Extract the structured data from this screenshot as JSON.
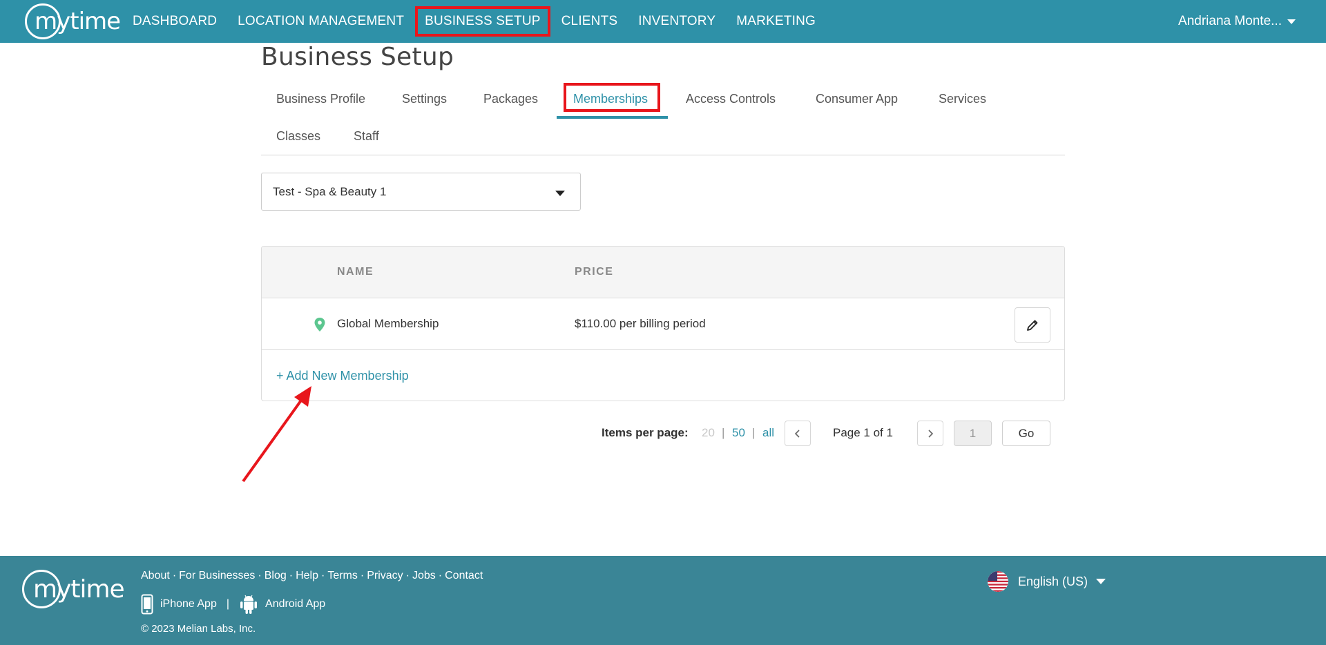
{
  "nav": {
    "items": [
      "DASHBOARD",
      "LOCATION MANAGEMENT",
      "BUSINESS SETUP",
      "CLIENTS",
      "INVENTORY",
      "MARKETING"
    ],
    "active": "BUSINESS SETUP",
    "user_name": "Andriana Monte..."
  },
  "logo_text": "mytime",
  "page": {
    "title": "Business Setup",
    "tabs_row1": [
      "Business Profile",
      "Settings",
      "Packages",
      "Memberships",
      "Access Controls",
      "Consumer App",
      "Services"
    ],
    "tabs_row2": [
      "Classes",
      "Staff"
    ],
    "active_tab": "Memberships"
  },
  "location_select": {
    "value": "Test - Spa & Beauty 1"
  },
  "table": {
    "headers": {
      "name": "NAME",
      "price": "PRICE"
    },
    "rows": [
      {
        "name": "Global Membership",
        "price": "$110.00 per billing period",
        "icon": "location-pin-icon"
      }
    ],
    "add_link": "+ Add New Membership"
  },
  "pagination": {
    "items_per_page_label": "Items per page:",
    "options": [
      "20",
      "50",
      "all"
    ],
    "separator": "|",
    "page_text": "Page 1 of 1",
    "page_input": "1",
    "go_label": "Go"
  },
  "footer": {
    "links": [
      "About",
      "For Businesses",
      "Blog",
      "Help",
      "Terms",
      "Privacy",
      "Jobs",
      "Contact"
    ],
    "link_separator": "·",
    "iphone_app": "iPhone App",
    "android_app": "Android App",
    "app_separator": "|",
    "copyright": "© 2023 Melian Labs, Inc.",
    "language": "English (US)"
  },
  "colors": {
    "brand_teal": "#2e91a8",
    "footer_teal": "#3a8596",
    "annotation_red": "#e8161c",
    "pin_green": "#5cc68f"
  }
}
